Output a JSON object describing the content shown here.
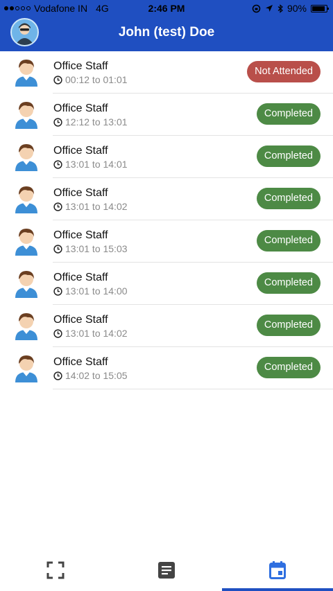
{
  "status_bar": {
    "carrier": "Vodafone IN",
    "network": "4G",
    "time": "2:46 PM",
    "battery": "90%",
    "battery_level": 0.9
  },
  "header": {
    "title": "John (test) Doe",
    "avatar_icon": "user-avatar-icon"
  },
  "entries": [
    {
      "name": "Office Staff",
      "time": "00:12 to 01:01",
      "status": "Not Attended",
      "status_color": "#b94f4a"
    },
    {
      "name": "Office Staff",
      "time": "12:12 to 13:01",
      "status": "Completed",
      "status_color": "#4d8a45"
    },
    {
      "name": "Office Staff",
      "time": "13:01 to 14:01",
      "status": "Completed",
      "status_color": "#4d8a45"
    },
    {
      "name": "Office Staff",
      "time": "13:01 to 14:02",
      "status": "Completed",
      "status_color": "#4d8a45"
    },
    {
      "name": "Office Staff",
      "time": "13:01 to 15:03",
      "status": "Completed",
      "status_color": "#4d8a45"
    },
    {
      "name": "Office Staff",
      "time": "13:01 to 14:00",
      "status": "Completed",
      "status_color": "#4d8a45"
    },
    {
      "name": "Office Staff",
      "time": "13:01 to 14:02",
      "status": "Completed",
      "status_color": "#4d8a45"
    },
    {
      "name": "Office Staff",
      "time": "14:02 to 15:05",
      "status": "Completed",
      "status_color": "#4d8a45"
    }
  ],
  "tabbar": {
    "tabs": [
      {
        "icon": "scan-icon",
        "active": false
      },
      {
        "icon": "document-icon",
        "active": false
      },
      {
        "icon": "calendar-icon",
        "active": true
      }
    ]
  },
  "colors": {
    "brand": "#1f4fc1",
    "completed": "#4d8a45",
    "not_attended": "#b94f4a",
    "active_tab": "#2f6fe0",
    "inactive_tab": "#444444"
  }
}
